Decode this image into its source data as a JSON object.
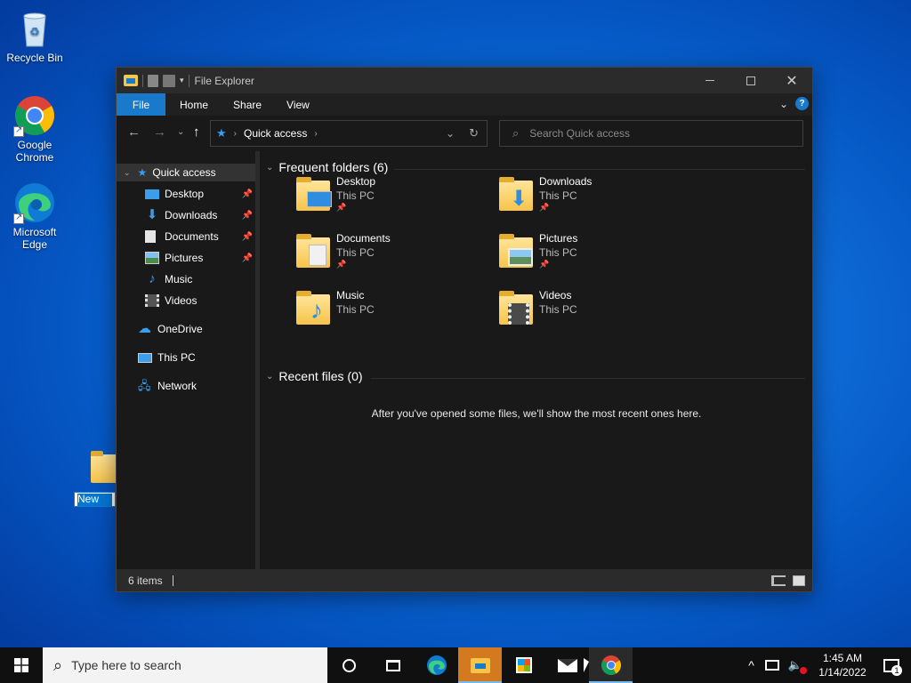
{
  "desktop": {
    "icons": [
      {
        "label": "Recycle Bin",
        "icon": "recycle-bin-icon"
      },
      {
        "label": "Google Chrome",
        "icon": "chrome-icon"
      },
      {
        "label": "Microsoft Edge",
        "icon": "edge-icon"
      }
    ],
    "new_folder_label": "New fol"
  },
  "window": {
    "title": "File Explorer",
    "ribbon_tabs": [
      "File",
      "Home",
      "Share",
      "View"
    ],
    "address": {
      "location": "Quick access"
    },
    "search_placeholder": "Search Quick access",
    "sidebar": {
      "quick_access": "Quick access",
      "items": [
        {
          "label": "Desktop",
          "pinned": true
        },
        {
          "label": "Downloads",
          "pinned": true
        },
        {
          "label": "Documents",
          "pinned": true
        },
        {
          "label": "Pictures",
          "pinned": true
        },
        {
          "label": "Music",
          "pinned": false
        },
        {
          "label": "Videos",
          "pinned": false
        }
      ],
      "onedrive": "OneDrive",
      "this_pc": "This PC",
      "network": "Network"
    },
    "frequent_header": "Frequent folders (6)",
    "frequent_folders": [
      {
        "name": "Desktop",
        "location": "This PC",
        "pinned": true
      },
      {
        "name": "Downloads",
        "location": "This PC",
        "pinned": true
      },
      {
        "name": "Documents",
        "location": "This PC",
        "pinned": true
      },
      {
        "name": "Pictures",
        "location": "This PC",
        "pinned": true
      },
      {
        "name": "Music",
        "location": "This PC",
        "pinned": false
      },
      {
        "name": "Videos",
        "location": "This PC",
        "pinned": false
      }
    ],
    "recent_header": "Recent files (0)",
    "recent_empty": "After you've opened some files, we'll show the most recent ones here.",
    "status": "6 items"
  },
  "taskbar": {
    "search_placeholder": "Type here to search",
    "time": "1:45 AM",
    "date": "1/14/2022",
    "notification_count": "1"
  },
  "colors": {
    "accent": "#1979ca",
    "explorer_bg": "#191919",
    "taskbar_bg": "#101010"
  }
}
